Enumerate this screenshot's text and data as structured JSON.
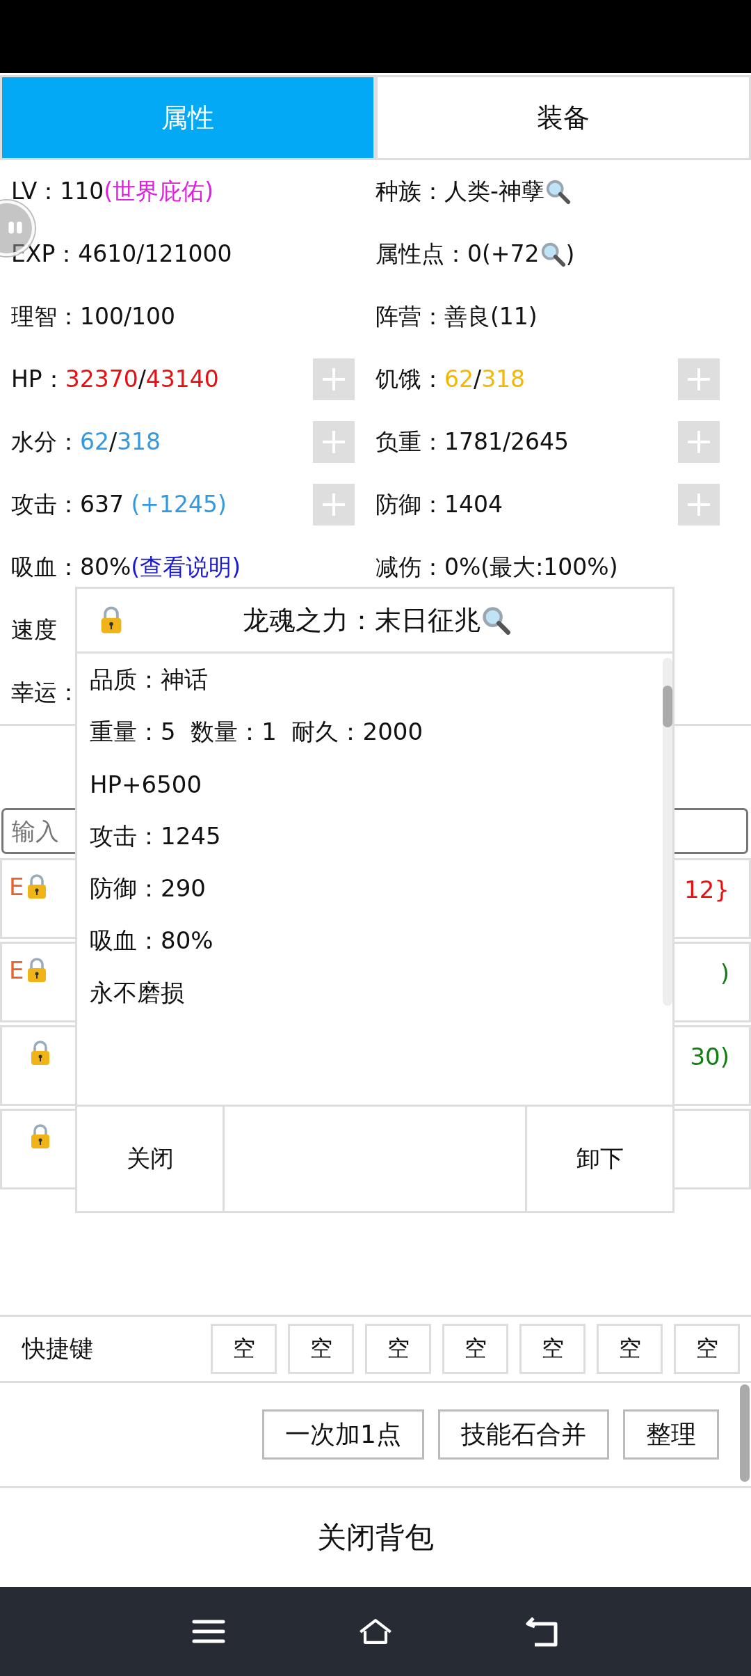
{
  "tabs": [
    {
      "label": "属性",
      "selected": true
    },
    {
      "label": "装备",
      "selected": false
    }
  ],
  "stats": [
    {
      "kind": "normal",
      "plus": false,
      "parts": [
        {
          "kind": "text",
          "text": "LV：110"
        },
        {
          "kind": "text",
          "text": "(世界庇佑)",
          "color": "#e01ee0"
        }
      ]
    },
    {
      "kind": "normal",
      "plus": false,
      "parts": [
        {
          "kind": "text",
          "text": "种族：人类-神孽"
        },
        {
          "kind": "magnifier"
        }
      ]
    },
    {
      "kind": "normal",
      "plus": false,
      "parts": [
        {
          "kind": "text",
          "text": "EXP：4610/121000"
        }
      ]
    },
    {
      "kind": "normal",
      "plus": false,
      "parts": [
        {
          "kind": "text",
          "text": "属性点：0(+72"
        },
        {
          "kind": "magnifier"
        },
        {
          "kind": "text",
          "text": ")"
        }
      ]
    },
    {
      "kind": "normal",
      "plus": false,
      "parts": [
        {
          "kind": "text",
          "text": "理智：100/100"
        }
      ]
    },
    {
      "kind": "normal",
      "plus": false,
      "parts": [
        {
          "kind": "text",
          "text": "阵营：善良(11)"
        }
      ]
    },
    {
      "kind": "normal",
      "plus": true,
      "parts": [
        {
          "kind": "text",
          "text": "HP："
        },
        {
          "kind": "text",
          "text": "32370",
          "color": "#e81010"
        },
        {
          "kind": "text",
          "text": "/"
        },
        {
          "kind": "text",
          "text": "43140",
          "color": "#e81010"
        }
      ]
    },
    {
      "kind": "normal",
      "plus": true,
      "parts": [
        {
          "kind": "text",
          "text": "饥饿："
        },
        {
          "kind": "text",
          "text": "62",
          "color": "#f5b800"
        },
        {
          "kind": "text",
          "text": "/"
        },
        {
          "kind": "text",
          "text": "318",
          "color": "#f5b800"
        }
      ]
    },
    {
      "kind": "normal",
      "plus": true,
      "parts": [
        {
          "kind": "text",
          "text": "水分："
        },
        {
          "kind": "text",
          "text": "62",
          "color": "#3399e0"
        },
        {
          "kind": "text",
          "text": "/"
        },
        {
          "kind": "text",
          "text": "318",
          "color": "#3399e0"
        }
      ]
    },
    {
      "kind": "normal",
      "plus": true,
      "parts": [
        {
          "kind": "text",
          "text": "负重：1781/2645"
        }
      ]
    },
    {
      "kind": "normal",
      "plus": true,
      "parts": [
        {
          "kind": "text",
          "text": "攻击：637 "
        },
        {
          "kind": "text",
          "text": "(+1245)",
          "color": "#3399e0"
        }
      ]
    },
    {
      "kind": "normal",
      "plus": true,
      "parts": [
        {
          "kind": "text",
          "text": "防御：1404"
        }
      ]
    },
    {
      "kind": "normal",
      "plus": false,
      "parts": [
        {
          "kind": "text",
          "text": "吸血：80%"
        },
        {
          "kind": "text",
          "text": "(查看说明)",
          "color": "#1a1ad0"
        }
      ]
    },
    {
      "kind": "normal",
      "plus": false,
      "parts": [
        {
          "kind": "text",
          "text": "减伤：0%(最大:100%)"
        }
      ]
    },
    {
      "kind": "normal",
      "plus": false,
      "parts": [
        {
          "kind": "text",
          "text": "速度"
        }
      ]
    },
    {
      "kind": "blank",
      "plus": false
    },
    {
      "kind": "normal",
      "plus": false,
      "parts": [
        {
          "kind": "text",
          "text": "幸运："
        }
      ]
    }
  ],
  "search": {
    "placeholder": "输入"
  },
  "items": [
    {
      "tag": "E",
      "locked": true,
      "tail": {
        "text": "12}",
        "color": "#e81010"
      }
    },
    {
      "tag": "E",
      "locked": true,
      "tail": {
        "text": ")",
        "color": "#108010"
      }
    },
    {
      "locked": true,
      "tail": {
        "text": "30)",
        "color": "#108010"
      }
    },
    {
      "locked": true
    }
  ],
  "popup": {
    "locked": true,
    "title": "龙魂之力：末日征兆",
    "lines": [
      "品质：神话",
      "重量：5  数量：1  耐久：2000",
      "HP+6500",
      "攻击：1245",
      "防御：290",
      "吸血：80%",
      "永不磨损"
    ],
    "buttons": [
      {
        "kind": "button",
        "label": "关闭"
      },
      {
        "kind": "blank"
      },
      {
        "kind": "button",
        "label": "卸下"
      }
    ]
  },
  "quickbar": {
    "label": "快捷键",
    "slots": [
      "空",
      "空",
      "空",
      "空",
      "空",
      "空",
      "空"
    ]
  },
  "actions": [
    "一次加1点",
    "技能石合并",
    "整理"
  ],
  "close_label": "关闭背包"
}
